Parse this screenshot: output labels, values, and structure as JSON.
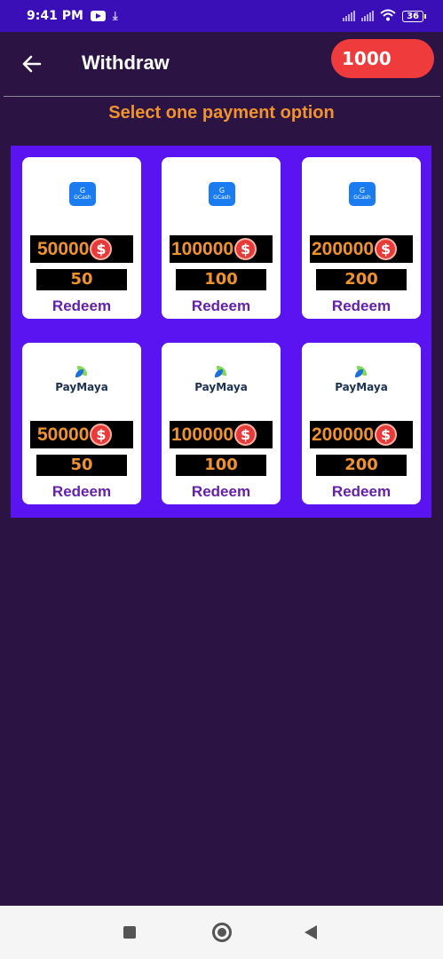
{
  "status_bar": {
    "time": "9:41 PM",
    "battery": "36"
  },
  "header": {
    "title": "Withdraw",
    "balance": "1000"
  },
  "subtitle": "Select one payment option",
  "cards": [
    {
      "provider": "GCash",
      "coins": "50000",
      "amount": "50",
      "redeem": "Redeem"
    },
    {
      "provider": "GCash",
      "coins": "100000",
      "amount": "100",
      "redeem": "Redeem"
    },
    {
      "provider": "GCash",
      "coins": "200000",
      "amount": "200",
      "redeem": "Redeem"
    },
    {
      "provider": "PayMaya",
      "coins": "50000",
      "amount": "50",
      "redeem": "Redeem"
    },
    {
      "provider": "PayMaya",
      "coins": "100000",
      "amount": "100",
      "redeem": "Redeem"
    },
    {
      "provider": "PayMaya",
      "coins": "200000",
      "amount": "200",
      "redeem": "Redeem"
    }
  ],
  "logos": {
    "gcash_mark": "G",
    "gcash_text": "GCash",
    "paymaya_text": "PayMaya"
  },
  "coin_symbol": "$",
  "colors": {
    "background": "#2b1443",
    "status_bar": "#3a0fb8",
    "panel": "#5a14f2",
    "accent_orange": "#f0932e",
    "balance_red": "#ef3b3b",
    "redeem_purple": "#6520a8"
  },
  "icons": {
    "back": "arrow-left-icon",
    "coin": "dollar-coin-icon",
    "nav_recents": "square-icon",
    "nav_home": "circle-icon",
    "nav_back": "triangle-back-icon"
  }
}
